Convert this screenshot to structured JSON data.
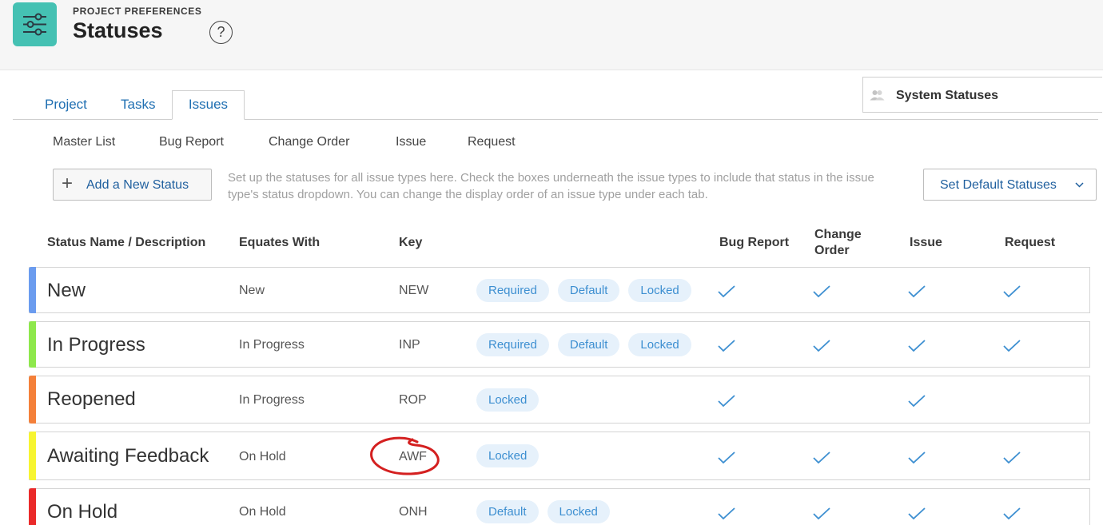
{
  "header": {
    "eyebrow": "PROJECT PREFERENCES",
    "title": "Statuses",
    "help_symbol": "?",
    "app_icon": "sliders-icon"
  },
  "system": {
    "label": "System Statuses",
    "icon": "users-icon"
  },
  "tabs": [
    {
      "label": "Project",
      "active": false
    },
    {
      "label": "Tasks",
      "active": false
    },
    {
      "label": "Issues",
      "active": true
    }
  ],
  "subtabs": [
    {
      "label": "Master List"
    },
    {
      "label": "Bug Report"
    },
    {
      "label": "Change Order"
    },
    {
      "label": "Issue"
    },
    {
      "label": "Request"
    }
  ],
  "actions": {
    "add_symbol": "+",
    "add_label": "Add a New Status",
    "help_text": "Set up the statuses for all issue types here. Check the boxes underneath the issue types to include that status in the issue type's status dropdown. You can change the display order of an issue type under each tab.",
    "default_label": "Set Default Statuses"
  },
  "columns": {
    "name": "Status Name / Description",
    "equates": "Equates With",
    "key": "Key",
    "bug_report": "Bug Report",
    "change_order_1": "Change",
    "change_order_2": "Order",
    "issue": "Issue",
    "request": "Request"
  },
  "rows": [
    {
      "name": "New",
      "equates": "New",
      "key": "NEW",
      "color": "#6b9cef",
      "tags": [
        "Required",
        "Default",
        "Locked"
      ],
      "bug_report": true,
      "change_order": true,
      "issue": true,
      "request": true
    },
    {
      "name": "In Progress",
      "equates": "In Progress",
      "key": "INP",
      "color": "#8ee84c",
      "tags": [
        "Required",
        "Default",
        "Locked"
      ],
      "bug_report": true,
      "change_order": true,
      "issue": true,
      "request": true
    },
    {
      "name": "Reopened",
      "equates": "In Progress",
      "key": "ROP",
      "color": "#f4803a",
      "tags": [
        "Locked"
      ],
      "bug_report": true,
      "change_order": false,
      "issue": true,
      "request": false
    },
    {
      "name": "Awaiting Feedback",
      "equates": "On Hold",
      "key": "AWF",
      "color": "#f7f531",
      "tags": [
        "Locked"
      ],
      "bug_report": true,
      "change_order": true,
      "issue": true,
      "request": true
    },
    {
      "name": "On Hold",
      "equates": "On Hold",
      "key": "ONH",
      "color": "#ea2a2a",
      "tags": [
        "Default",
        "Locked"
      ],
      "bug_report": true,
      "change_order": true,
      "issue": true,
      "request": true
    }
  ],
  "colors": {
    "accent": "#1f6fb2",
    "check": "#3d8fd1",
    "tag_bg": "#e6f1fb",
    "app_icon_bg": "#45c1b3",
    "annotation": "#d42020"
  }
}
